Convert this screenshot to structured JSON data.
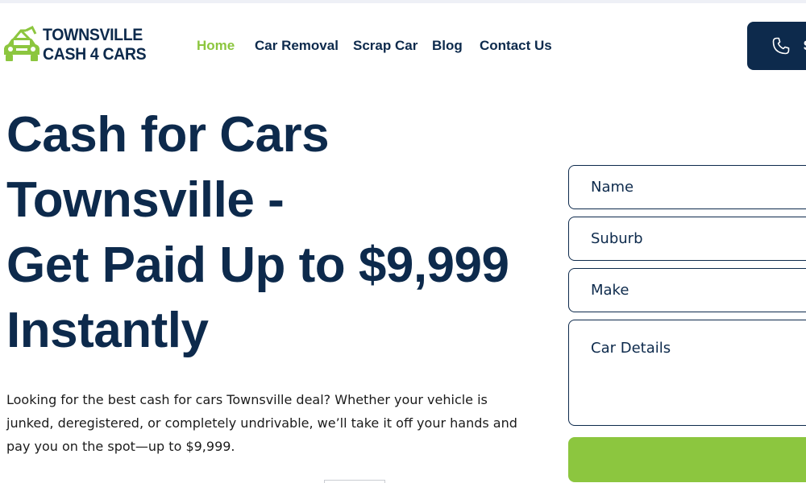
{
  "brand": {
    "line1": "TOWNSVILLE",
    "line2": "CASH 4 CARS",
    "primary_color": "#0d2a4c",
    "accent_color": "#8cc63f"
  },
  "nav": {
    "items": [
      {
        "label": "Home",
        "active": true
      },
      {
        "label": "Car Removal",
        "active": false
      },
      {
        "label": "Scrap Car",
        "active": false
      },
      {
        "label": "Blog",
        "active": false
      },
      {
        "label": "Contact Us",
        "active": false
      }
    ]
  },
  "header": {
    "call_icon": "phone-icon",
    "call_label": "$"
  },
  "hero": {
    "title_lines": [
      "Cash for Cars",
      "Townsville -",
      "Get Paid Up to $9,999",
      "Instantly"
    ],
    "description": "Looking for the best cash for cars Townsville deal? Whether your vehicle is junked, deregistered, or completely undrivable, we’ll take it off your hands and pay you on the spot—up to $9,999."
  },
  "form": {
    "name_placeholder": "Name",
    "suburb_placeholder": "Suburb",
    "make_placeholder": "Make",
    "details_placeholder": "Car Details",
    "submit_label": ""
  }
}
